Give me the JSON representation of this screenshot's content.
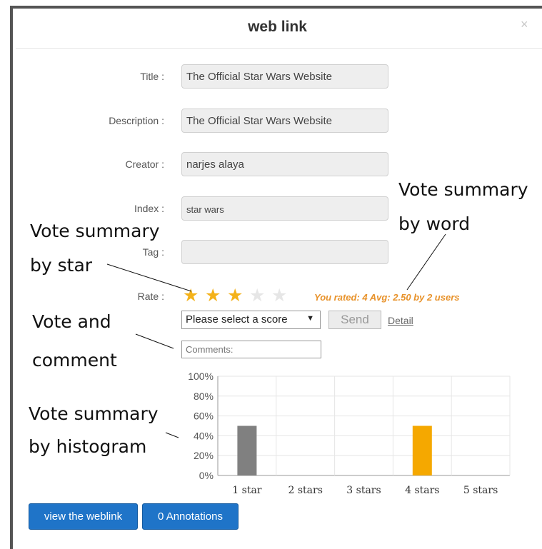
{
  "dialog": {
    "title": "web link",
    "close": "×"
  },
  "form": {
    "title": {
      "label": "Title :",
      "value": "The Official Star Wars Website"
    },
    "description": {
      "label": "Description :",
      "value": "The Official Star Wars Website"
    },
    "creator": {
      "label": "Creator :",
      "value": "narjes alaya"
    },
    "index": {
      "label": "Index :",
      "value": "star wars"
    },
    "tag": {
      "label": "Tag :",
      "value": ""
    },
    "rate": {
      "label": "Rate :",
      "stars_filled": 3,
      "stars_total": 5,
      "summary": "You rated: 4 Avg: 2.50 by 2 users"
    }
  },
  "vote": {
    "select_value": "Please select a score",
    "send_label": "Send",
    "detail_label": "Detail",
    "comments_placeholder": "Comments:"
  },
  "annotations": {
    "by_word_1": "Vote summary",
    "by_word_2": "by word",
    "by_star_1": "Vote summary",
    "by_star_2": "by star",
    "comment_1": "Vote and",
    "comment_2": "comment",
    "histogram_1": "Vote summary",
    "histogram_2": "by histogram"
  },
  "chart_data": {
    "type": "bar",
    "categories": [
      "1 star",
      "2 stars",
      "3 stars",
      "4 stars",
      "5 stars"
    ],
    "values": [
      50,
      0,
      0,
      50,
      0
    ],
    "bar_colors": [
      "#808080",
      "#808080",
      "#808080",
      "#f5a800",
      "#808080"
    ],
    "ylim": [
      0,
      100
    ],
    "yticks": [
      "0%",
      "20%",
      "40%",
      "60%",
      "80%",
      "100%"
    ],
    "grid": true
  },
  "footer": {
    "view_label": "view the weblink",
    "annotations_label": "0 Annotations"
  },
  "colors": {
    "accent": "#1f74c8",
    "rating_text": "#e8922a",
    "star_on": "#f4b21a"
  }
}
